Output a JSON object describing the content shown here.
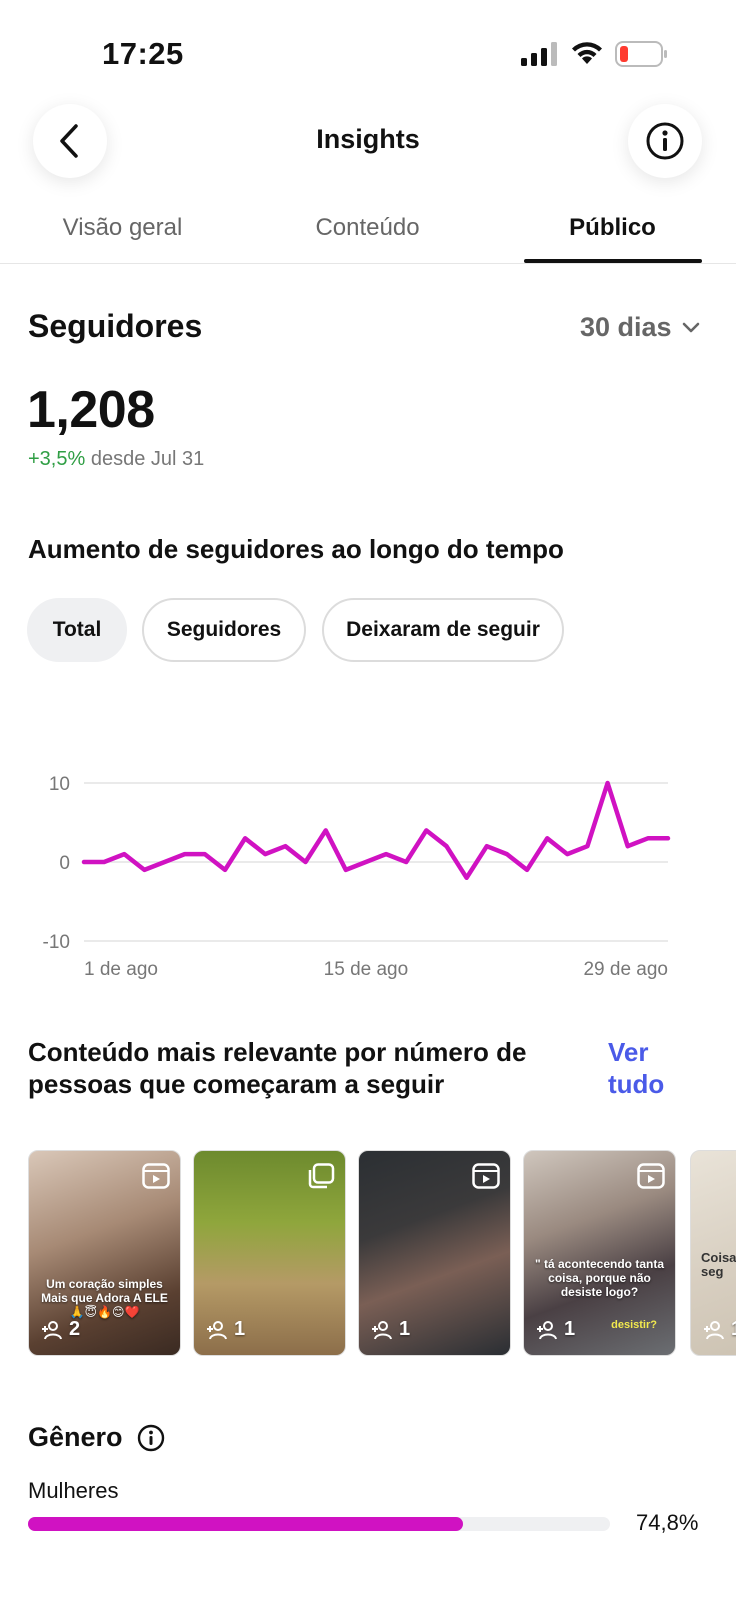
{
  "status_bar": {
    "time": "17:25",
    "battery_color": "#ff3b30"
  },
  "header": {
    "title": "Insights",
    "back_icon": "chevron-left-icon",
    "info_icon": "info-icon"
  },
  "tabs": [
    {
      "label": "Visão geral",
      "active": false
    },
    {
      "label": "Conteúdo",
      "active": false
    },
    {
      "label": "Público",
      "active": true
    }
  ],
  "followers": {
    "title": "Seguidores",
    "range": "30 dias",
    "count": "1,208",
    "delta": "+3,5%",
    "delta_suffix": "desde Jul 31",
    "delta_color": "#2f9e44"
  },
  "growth": {
    "title": "Aumento de seguidores ao longo do tempo",
    "chips": [
      {
        "label": "Total",
        "active": true
      },
      {
        "label": "Seguidores",
        "active": false
      },
      {
        "label": "Deixaram de seguir",
        "active": false
      }
    ]
  },
  "chart_data": {
    "type": "line",
    "title": "",
    "xlabel": "",
    "ylabel": "",
    "ylim": [
      -10,
      10
    ],
    "yticks": [
      "10",
      "0",
      "-10"
    ],
    "xticks": [
      "1 de ago",
      "15 de ago",
      "29 de ago"
    ],
    "grid": true,
    "line_color": "#d012c2",
    "x": [
      "1",
      "2",
      "3",
      "4",
      "5",
      "6",
      "7",
      "8",
      "9",
      "10",
      "11",
      "12",
      "13",
      "14",
      "15",
      "16",
      "17",
      "18",
      "19",
      "20",
      "21",
      "22",
      "23",
      "24",
      "25",
      "26",
      "27",
      "28",
      "29",
      "30"
    ],
    "values": [
      0,
      0,
      1,
      -1,
      0,
      1,
      1,
      -1,
      3,
      1,
      2,
      0,
      4,
      -1,
      0,
      1,
      0,
      4,
      2,
      -2,
      2,
      1,
      -1,
      3,
      1,
      2,
      10,
      2,
      3,
      3
    ]
  },
  "relevant": {
    "title": "Conteúdo mais relevante por número de pessoas que começaram a seguir",
    "link": "Ver tudo",
    "posts": [
      {
        "type": "reel-icon",
        "followers": "2",
        "caption": "Um coração simples Mais que Adora A ELE 🙏😇🔥😊❤️",
        "caption2": ""
      },
      {
        "type": "carousel-icon",
        "followers": "1",
        "caption": "",
        "caption2": ""
      },
      {
        "type": "reel-icon",
        "followers": "1",
        "caption": "",
        "caption2": ""
      },
      {
        "type": "reel-icon",
        "followers": "1",
        "caption": "\" tá acontecendo tanta coisa, porque não desiste logo?",
        "caption2": "desistir?"
      },
      {
        "type": "reel-icon",
        "followers": "1",
        "caption": "Coisa seg",
        "caption2": ""
      }
    ]
  },
  "gender": {
    "title": "Gênero",
    "info_icon": "info-icon",
    "women_label": "Mulheres",
    "women_pct": "74,8%",
    "women_fraction": 0.748,
    "bar_color": "#d012c2"
  }
}
